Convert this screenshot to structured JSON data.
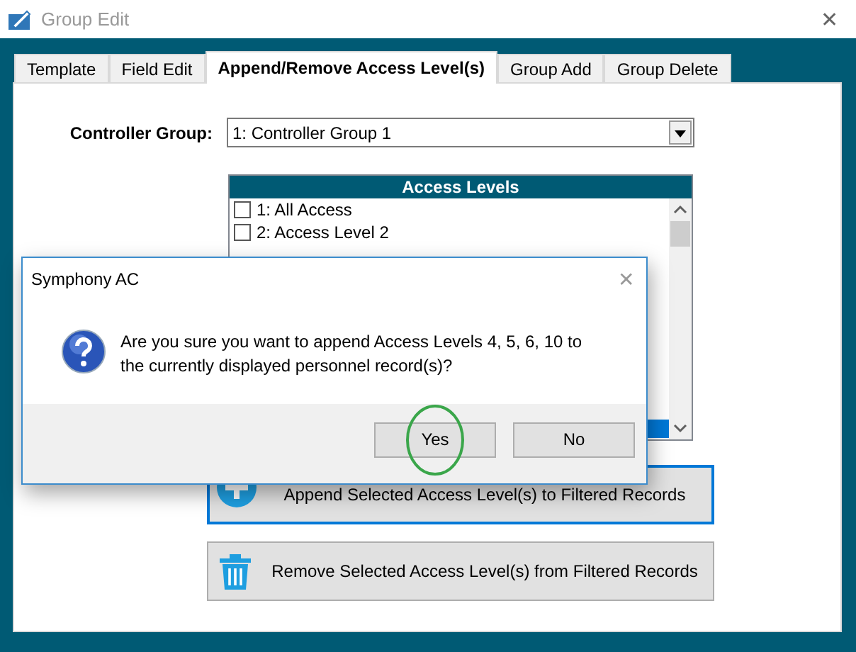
{
  "window": {
    "title": "Group Edit",
    "close": "✕"
  },
  "tabs": [
    {
      "label": "Template",
      "selected": false
    },
    {
      "label": "Field Edit",
      "selected": false
    },
    {
      "label": "Append/Remove Access Level(s)",
      "selected": true
    },
    {
      "label": "Group Add",
      "selected": false
    },
    {
      "label": "Group Delete",
      "selected": false
    }
  ],
  "controller_group": {
    "label": "Controller Group:",
    "value": "1:  Controller Group 1"
  },
  "access_levels": {
    "header": "Access Levels",
    "items": [
      {
        "label": "1:  All Access",
        "checked": false,
        "selected": false
      },
      {
        "label": "2:  Access Level 2",
        "checked": false,
        "selected": false
      },
      {
        "selected": true
      }
    ]
  },
  "actions": [
    {
      "kind": "append",
      "label": "Append Selected Access Level(s) to Filtered Records",
      "focused": true
    },
    {
      "kind": "remove",
      "label": "Remove Selected Access Level(s) from Filtered Records",
      "focused": false
    }
  ],
  "dialog": {
    "title": "Symphony AC",
    "close": "✕",
    "message": "Are you sure you want to append Access Levels 4, 5, 6, 10 to the currently displayed personnel record(s)?",
    "buttons": [
      {
        "label": "Yes",
        "circled": true
      },
      {
        "label": "No",
        "circled": false
      }
    ]
  }
}
